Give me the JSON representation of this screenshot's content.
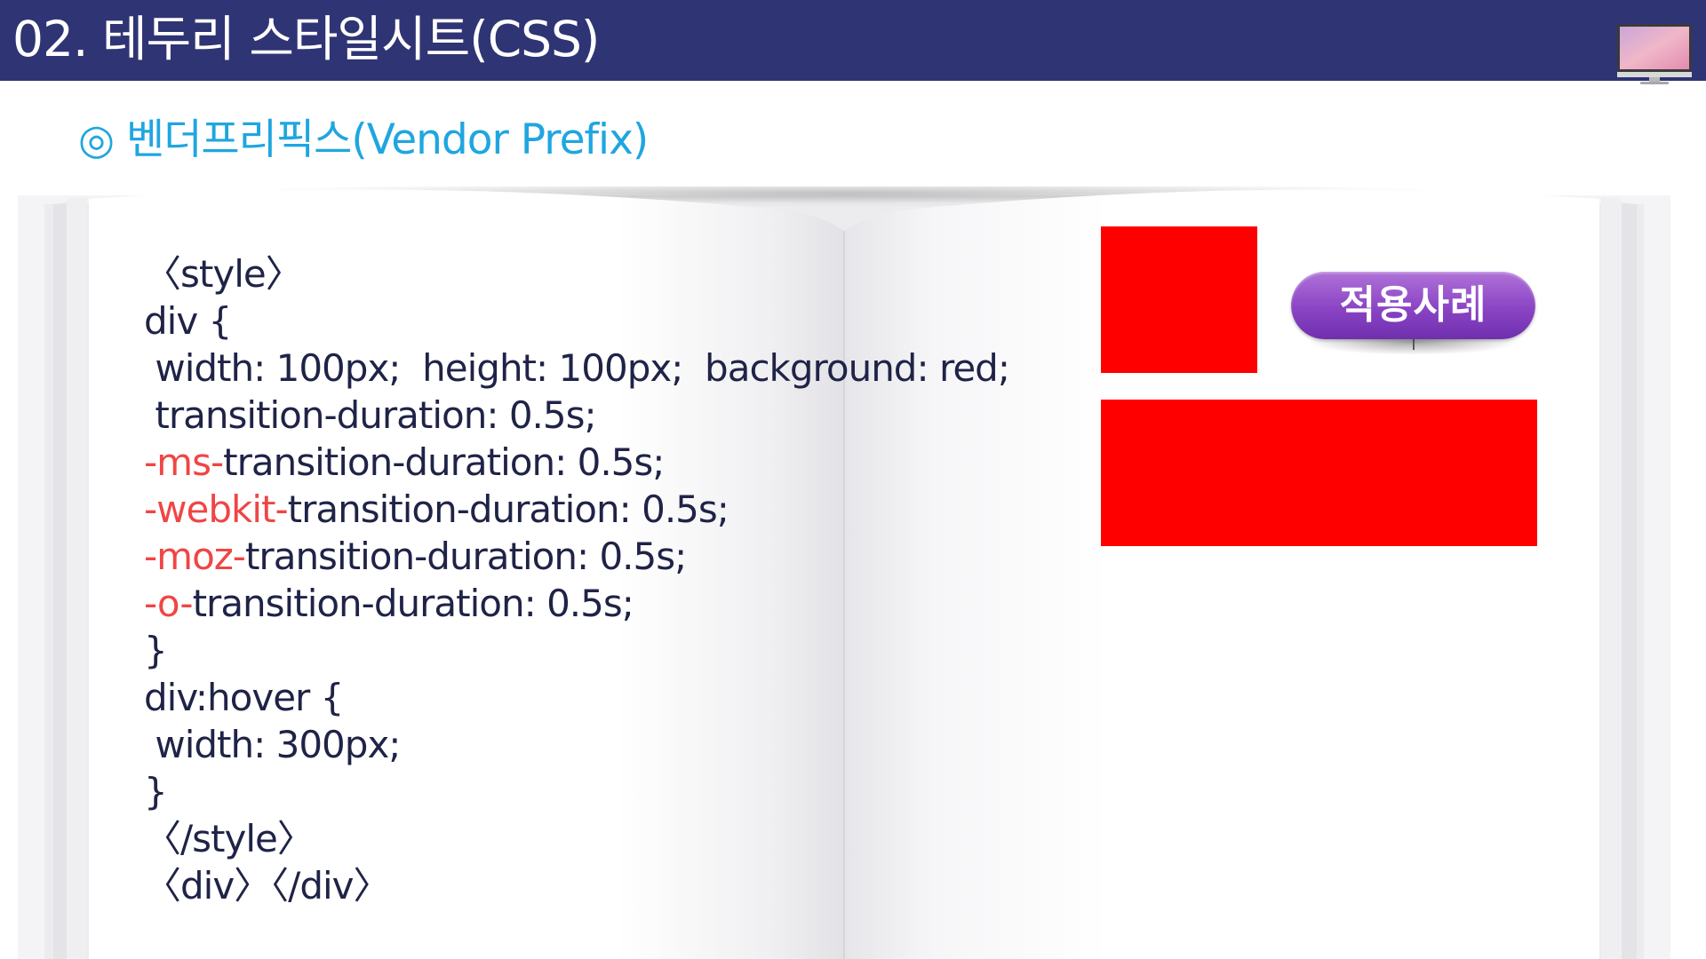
{
  "header": {
    "title": "02. 테두리 스타일시트(CSS)"
  },
  "section": {
    "heading": "◎ 벤더프리픽스(Vendor Prefix)"
  },
  "code": {
    "lines": [
      {
        "prefix": "",
        "text": "〈style〉"
      },
      {
        "prefix": "",
        "text": "div {"
      },
      {
        "prefix": "",
        "text": " width: 100px;  height: 100px;  background: red;"
      },
      {
        "prefix": "",
        "text": " transition-duration: 0.5s;"
      },
      {
        "prefix": "-ms-",
        "text": "transition-duration: 0.5s;"
      },
      {
        "prefix": "-webkit-",
        "text": "transition-duration: 0.5s;"
      },
      {
        "prefix": "-moz-",
        "text": "transition-duration: 0.5s;"
      },
      {
        "prefix": "-o-",
        "text": "transition-duration: 0.5s;"
      },
      {
        "prefix": "",
        "text": "}"
      },
      {
        "prefix": "",
        "text": "div:hover {"
      },
      {
        "prefix": "",
        "text": " width: 300px;"
      },
      {
        "prefix": "",
        "text": "}"
      },
      {
        "prefix": "",
        "text": "〈/style〉"
      },
      {
        "prefix": "",
        "text": "〈div〉〈/div〉"
      }
    ]
  },
  "demo": {
    "badge_label": "적용사례",
    "box_color": "#ff0000"
  },
  "colors": {
    "header_bg": "#2f3474",
    "heading": "#1fa6e0",
    "prefix": "#f04545",
    "code_text": "#1f2347",
    "badge": "#8a44c4"
  },
  "icons": {
    "monitor": "monitor-icon"
  }
}
